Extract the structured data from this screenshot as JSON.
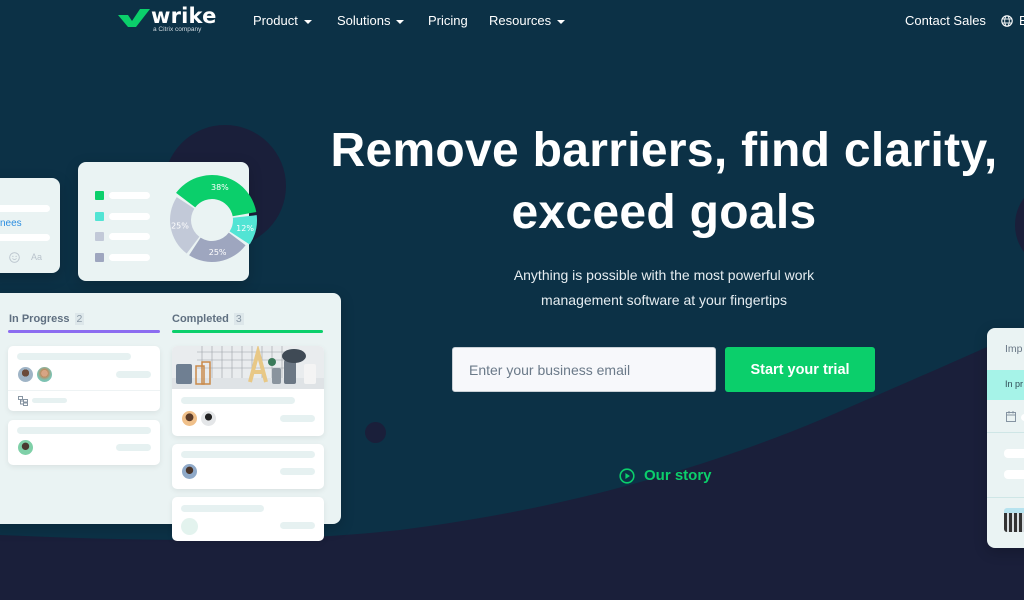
{
  "nav": {
    "logo_text": "wrike",
    "logo_subtext": "a Citrix company",
    "items": [
      {
        "label": "Product",
        "has_dropdown": true
      },
      {
        "label": "Solutions",
        "has_dropdown": true
      },
      {
        "label": "Pricing",
        "has_dropdown": false
      },
      {
        "label": "Resources",
        "has_dropdown": true
      }
    ],
    "contact_sales": "Contact Sales",
    "language_label": "E"
  },
  "hero": {
    "title_line1": "Remove barriers, find clarity,",
    "title_line2": "exceed goals",
    "subtitle_line1": "Anything is possible with the most powerful work",
    "subtitle_line2": "management software at your fingertips",
    "email_placeholder": "Enter your business email",
    "email_value": "",
    "cta_label": "Start your trial",
    "our_story_label": "Our story"
  },
  "colors": {
    "background": "#0c3146",
    "background_dark": "#1a1f3a",
    "brand_green": "#0bcf6b",
    "teal": "#52e4d4",
    "purple": "#8b6cf0",
    "slate_light": "#c2c9d8",
    "slate": "#9ea6bf"
  },
  "comment_card": {
    "mention_text": "nees",
    "format_label": "Aa"
  },
  "donut": {
    "segments": [
      {
        "label": "38%",
        "value": 38,
        "color": "#0bcf6b"
      },
      {
        "label": "12%",
        "value": 12,
        "color": "#52e4d4"
      },
      {
        "label": "25%",
        "value": 25,
        "color": "#9ea6bf"
      },
      {
        "label": "25%",
        "value": 25,
        "color": "#c2c9d8"
      }
    ]
  },
  "board": {
    "columns": [
      {
        "title": "In Progress",
        "count": "2",
        "color": "#8b6cf0"
      },
      {
        "title": "Completed",
        "count": "3",
        "color": "#0bcf6b"
      }
    ]
  },
  "right_card": {
    "header": "Imp",
    "status": "In pr"
  }
}
